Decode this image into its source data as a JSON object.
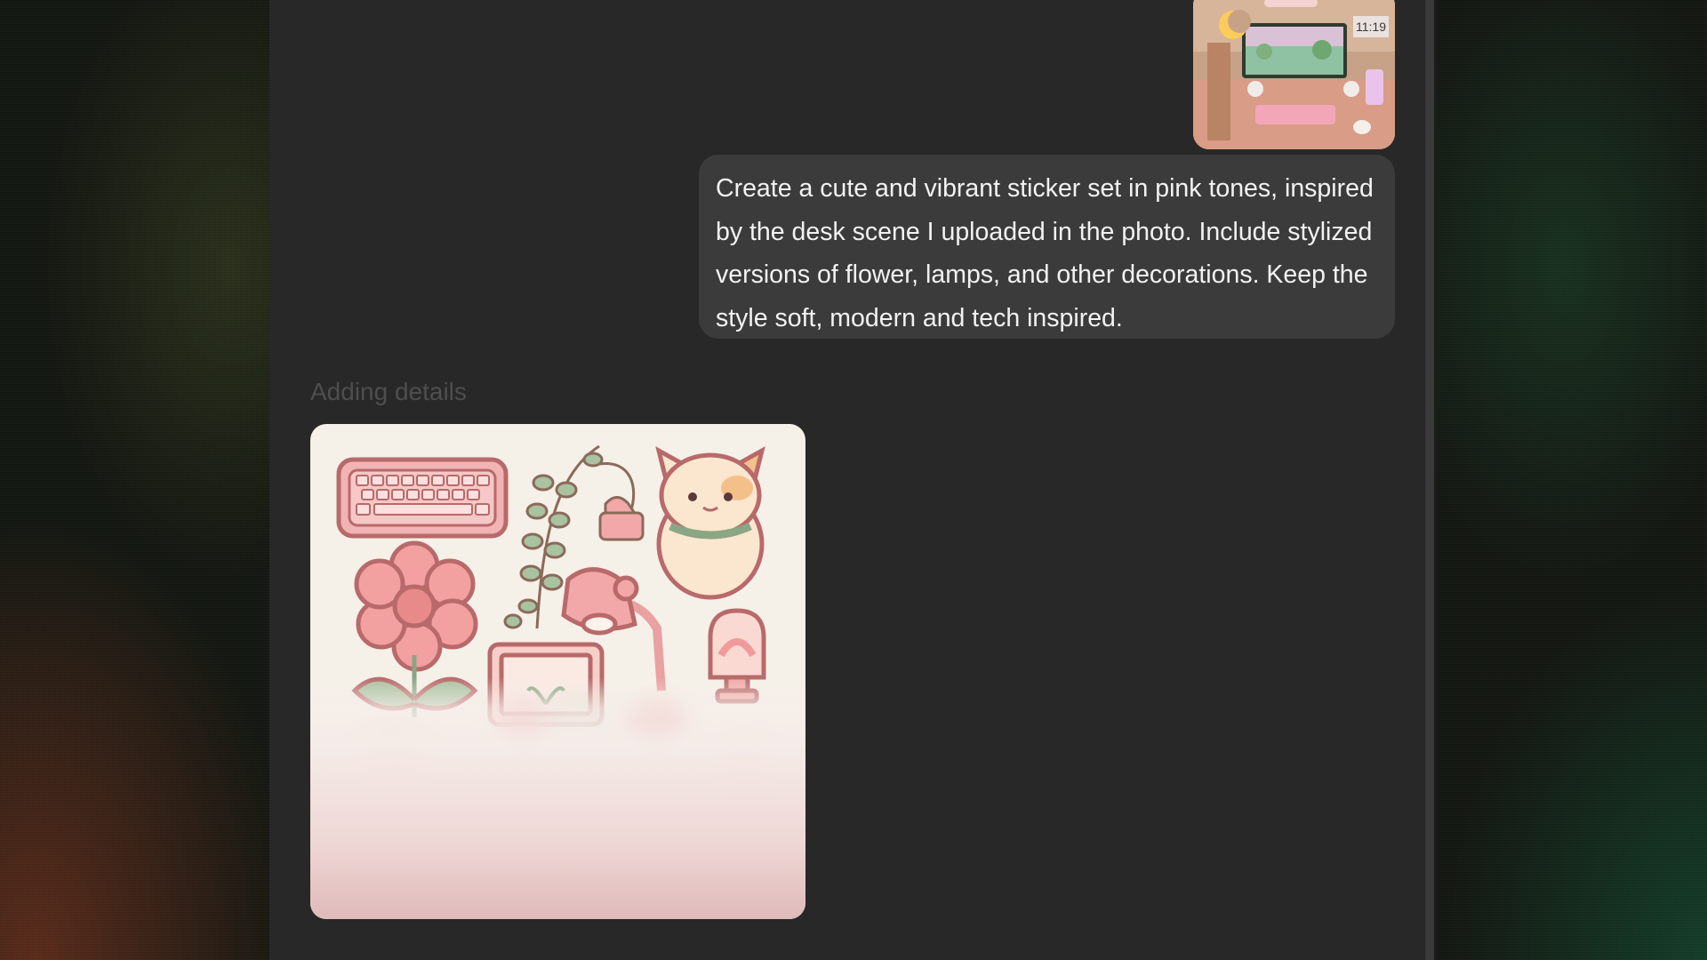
{
  "conversation": {
    "user_message": "Create a cute and vibrant sticker set in pink tones, inspired by the desk scene I uploaded in the photo. Include stylized versions of flower, lamps, and other decorations. Keep the style soft, modern and tech inspired.",
    "attachment_clock_text": "11:19",
    "generation_status": "Adding details"
  },
  "icons": {
    "keyboard": "keyboard-sticker",
    "plant": "hanging-plant-sticker",
    "cat": "cat-sticker",
    "flower": "flower-sticker",
    "lamp": "desk-lamp-sticker",
    "monitor": "monitor-sticker",
    "night_lamp": "night-lamp-sticker"
  },
  "colors": {
    "panel_bg": "#282828",
    "bubble_bg": "#3b3b3b",
    "sticker_outline": "#b86a6a",
    "sticker_pink": "#f2a8a8",
    "sticker_green": "#a9c2a0",
    "image_bg": "#f5f0e8"
  }
}
